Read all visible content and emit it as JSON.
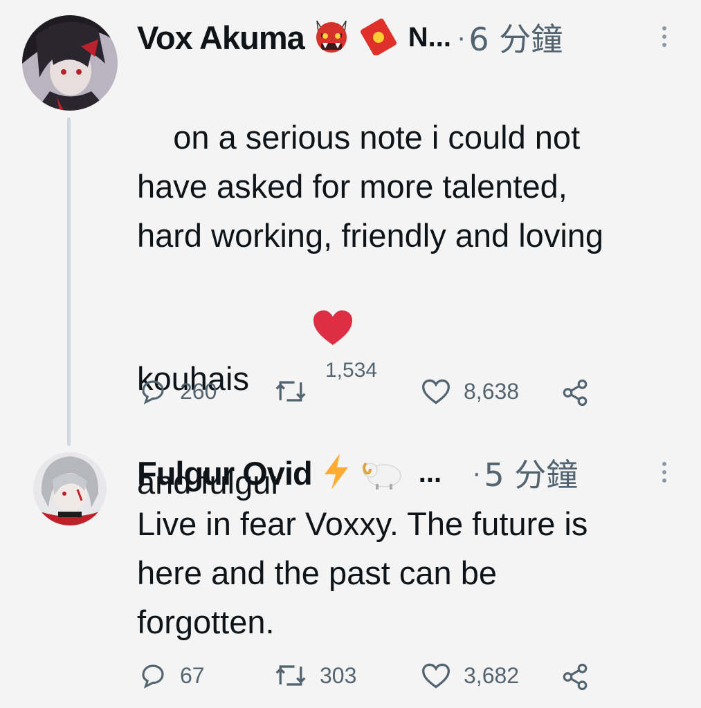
{
  "tweets": [
    {
      "author": "Vox Akuma",
      "badges": [
        "ogre-emoji",
        "red-envelope-emoji"
      ],
      "name_suffix": "N...",
      "separator": "·",
      "time": "6 分鐘",
      "text": "on a serious note i could not\nhave asked for more talented,\nhard working, friendly and loving\nkouhais ",
      "heart_emoji": "red-heart-emoji",
      "text2": "and fulgur",
      "replies": "260",
      "retweets": "1,534",
      "likes": "8,638"
    },
    {
      "author": "Fulgur Ovid",
      "badges": [
        "lightning-emoji",
        "ram-emoji"
      ],
      "name_suffix": "...",
      "separator": "·",
      "time": "5 分鐘",
      "text": "Live in fear Voxxy. The future is\nhere and the past can be\nforgotten.",
      "replies": "67",
      "retweets": "303",
      "likes": "3,682"
    }
  ],
  "colors": {
    "background": "#f4f4f4",
    "text": "#0f1419",
    "secondary": "#536471",
    "thread_line": "#cfd9de",
    "heart": "#e0245e"
  }
}
